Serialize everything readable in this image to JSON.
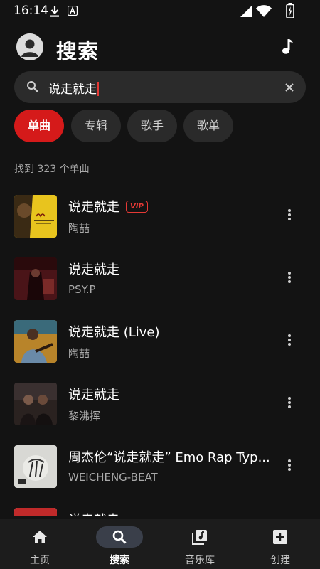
{
  "status_bar": {
    "time": "16:14"
  },
  "header": {
    "title": "搜索"
  },
  "search": {
    "query": "说走就走"
  },
  "filters": {
    "chips": [
      {
        "label": "单曲",
        "active": true
      },
      {
        "label": "专辑",
        "active": false
      },
      {
        "label": "歌手",
        "active": false
      },
      {
        "label": "歌单",
        "active": false
      }
    ],
    "result_count": "找到 323 个单曲"
  },
  "results": [
    {
      "title": "说走就走",
      "artist": "陶喆",
      "badge": "VIP"
    },
    {
      "title": "说走就走",
      "artist": "PSY.P"
    },
    {
      "title": "说走就走 (Live)",
      "artist": "陶喆"
    },
    {
      "title": "说走就走",
      "artist": "黎沸挥"
    },
    {
      "title": "周杰伦“说走就走” Emo Rap Typ...",
      "artist": "WEICHENG-BEAT"
    },
    {
      "title": "说走就走",
      "artist": ""
    }
  ],
  "bottom_nav": [
    {
      "label": "主页",
      "icon": "home-icon",
      "active": false
    },
    {
      "label": "搜索",
      "icon": "search-icon",
      "active": true
    },
    {
      "label": "音乐库",
      "icon": "library-icon",
      "active": false
    },
    {
      "label": "创建",
      "icon": "add-box-icon",
      "active": false
    }
  ],
  "colors": {
    "accent": "#d51a1a",
    "background": "#131313",
    "surface": "#2b2b2b",
    "nav_bar": "#1c1c1c"
  }
}
